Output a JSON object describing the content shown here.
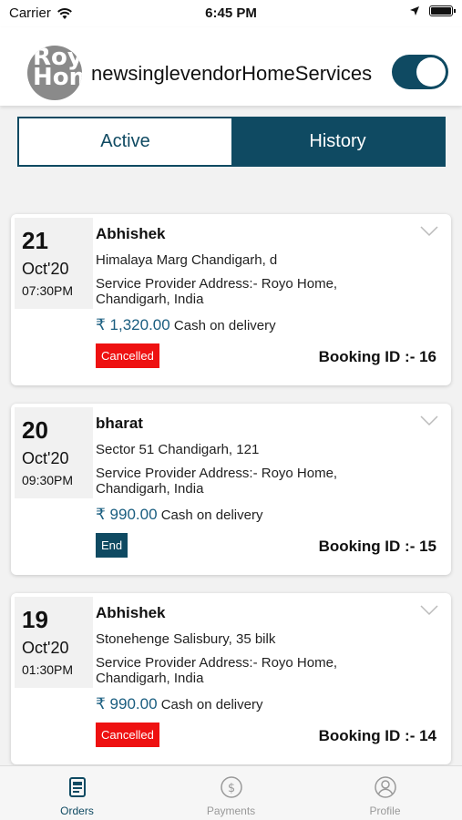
{
  "status_bar": {
    "carrier": "Carrier",
    "time": "6:45 PM"
  },
  "header": {
    "avatar_text": "Royo Home",
    "title": "newsinglevendorHomeServices",
    "toggle_on": true
  },
  "tabs": [
    {
      "label": "Active"
    },
    {
      "label": "History"
    }
  ],
  "orders": [
    {
      "day": "21",
      "month": "Oct'20",
      "time": "07:30PM",
      "name": "Abhishek",
      "address": "Himalaya Marg Chandigarh, d",
      "provider": "Service Provider Address:- Royo Home, Chandigarh, India",
      "price": "₹ 1,320.00",
      "payment": "Cash on delivery",
      "status": "Cancelled",
      "status_color": "#ee1111",
      "booking": "Booking ID :- 16"
    },
    {
      "day": "20",
      "month": "Oct'20",
      "time": "09:30PM",
      "name": "bharat",
      "address": "Sector 51 Chandigarh, 121",
      "provider": "Service Provider Address:- Royo Home, Chandigarh, India",
      "price": "₹ 990.00",
      "payment": "Cash on delivery",
      "status": "End",
      "status_color": "#0f4a62",
      "booking": "Booking ID :- 15"
    },
    {
      "day": "19",
      "month": "Oct'20",
      "time": "01:30PM",
      "name": "Abhishek",
      "address": "Stonehenge Salisbury, 35 bilk",
      "provider": "Service Provider Address:- Royo Home, Chandigarh, India",
      "price": "₹ 990.00",
      "payment": "Cash on delivery",
      "status": "Cancelled",
      "status_color": "#ee1111",
      "booking": "Booking ID :- 14"
    }
  ],
  "tabbar": [
    {
      "label": "Orders",
      "icon": "orders-icon"
    },
    {
      "label": "Payments",
      "icon": "payments-icon"
    },
    {
      "label": "Profile",
      "icon": "profile-icon"
    }
  ],
  "colors": {
    "primary": "#0f4a62",
    "cancelled": "#ee1111",
    "price": "#1a5e80"
  }
}
